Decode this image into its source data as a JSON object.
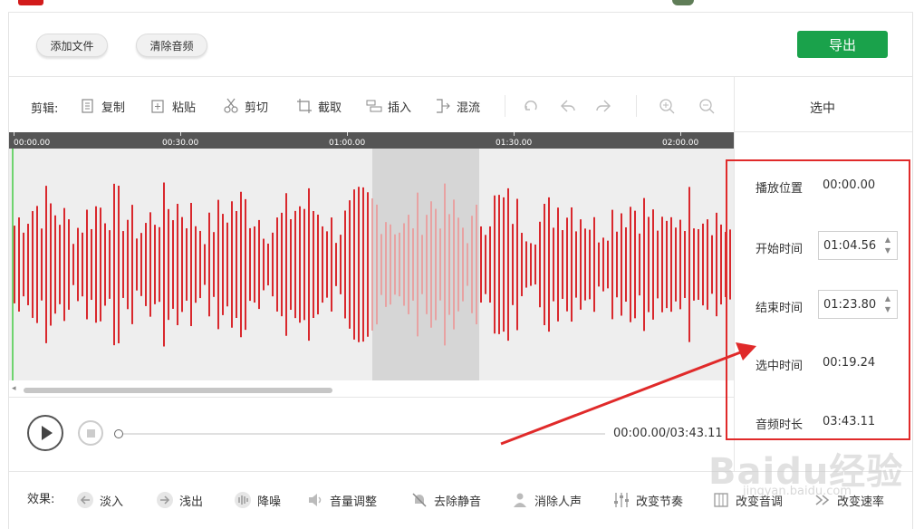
{
  "header": {
    "add_file_label": "添加文件",
    "clear_audio_label": "清除音频",
    "export_label": "导出"
  },
  "toolbar": {
    "edit_label": "剪辑:",
    "items": [
      {
        "label": "复制",
        "icon": "copy-icon"
      },
      {
        "label": "粘贴",
        "icon": "paste-icon"
      },
      {
        "label": "剪切",
        "icon": "scissors-icon"
      },
      {
        "label": "截取",
        "icon": "crop-icon"
      },
      {
        "label": "插入",
        "icon": "insert-icon"
      },
      {
        "label": "混流",
        "icon": "mix-icon"
      }
    ],
    "icon_buttons": [
      "refresh-icon",
      "undo-icon",
      "redo-icon",
      "zoom-in-icon",
      "zoom-out-icon"
    ]
  },
  "timeline": {
    "ticks": [
      "00:00.00",
      "00:30.00",
      "01:00.00",
      "01:30.00",
      "02:00.00"
    ]
  },
  "waveform": {
    "color": "#d9282d",
    "selected_color": "#e8a2a2"
  },
  "player": {
    "time_display": "00:00.00/03:43.11"
  },
  "side_panel": {
    "title": "选中",
    "play_position_label": "播放位置",
    "play_position_value": "00:00.00",
    "start_label": "开始时间",
    "start_value": "01:04.56",
    "end_label": "结束时间",
    "end_value": "01:23.80",
    "selected_label": "选中时间",
    "selected_value": "00:19.24",
    "duration_label": "音频时长",
    "duration_value": "03:43.11"
  },
  "effects": {
    "label": "效果:",
    "items": [
      {
        "label": "淡入",
        "icon": "fade-in-icon"
      },
      {
        "label": "浅出",
        "icon": "fade-out-icon"
      },
      {
        "label": "降噪",
        "icon": "denoise-icon"
      },
      {
        "label": "音量调整",
        "icon": "volume-icon"
      },
      {
        "label": "去除静音",
        "icon": "mute-remove-icon"
      },
      {
        "label": "消除人声",
        "icon": "voice-remove-icon"
      },
      {
        "label": "改变节奏",
        "icon": "tempo-icon"
      },
      {
        "label": "改变音调",
        "icon": "pitch-icon"
      },
      {
        "label": "改变速率",
        "icon": "rate-icon"
      }
    ]
  },
  "watermark": {
    "text": "Baidu经验",
    "sub": "jingyan.baidu.com"
  },
  "accent": {
    "green": "#1aa24b",
    "red": "#e02a2a"
  }
}
